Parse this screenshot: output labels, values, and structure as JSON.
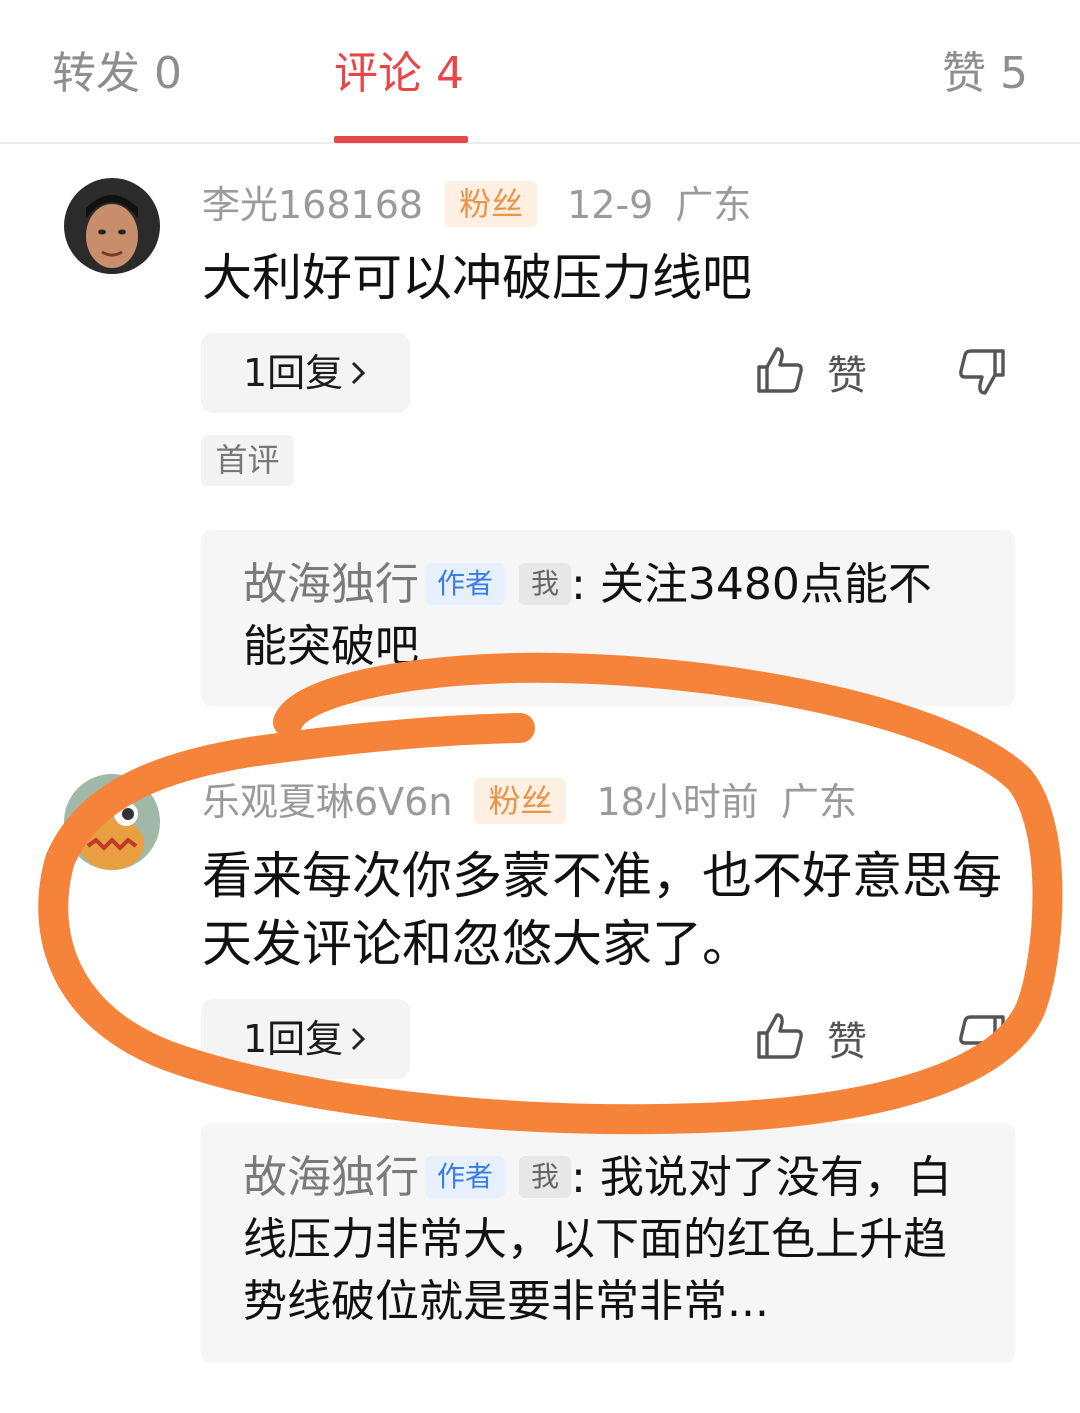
{
  "tabs": [
    {
      "label": "转发 0"
    },
    {
      "label": "评论 4"
    },
    {
      "label": "赞 5"
    }
  ],
  "comments": [
    {
      "username": "李光168168",
      "badge": "粉丝",
      "time": "12-9",
      "location": "广东",
      "text": "大利好可以冲破压力线吧",
      "reply_count": "1回复",
      "like_label": "赞",
      "tag": "首评",
      "reply": {
        "author": "故海独行",
        "author_badge": "作者",
        "me_badge": "我",
        "text": "关注3480点能不能突破吧"
      }
    },
    {
      "username": "乐观夏琳6V6n",
      "badge": "粉丝",
      "time": "18小时前",
      "location": "广东",
      "text": "看来每次你多蒙不准，也不好意思每天发评论和忽悠大家了。",
      "reply_count": "1回复",
      "like_label": "赞",
      "reply": {
        "author": "故海独行",
        "author_badge": "作者",
        "me_badge": "我",
        "text": "我说对了没有，白线压力非常大，以下面的红色上升趋势线破位就是要非常非常..."
      }
    }
  ],
  "colors": {
    "accent": "#e8474a",
    "fan_badge": "#e8944a",
    "author_badge": "#3b7de0",
    "annotation": "#f5833a"
  }
}
